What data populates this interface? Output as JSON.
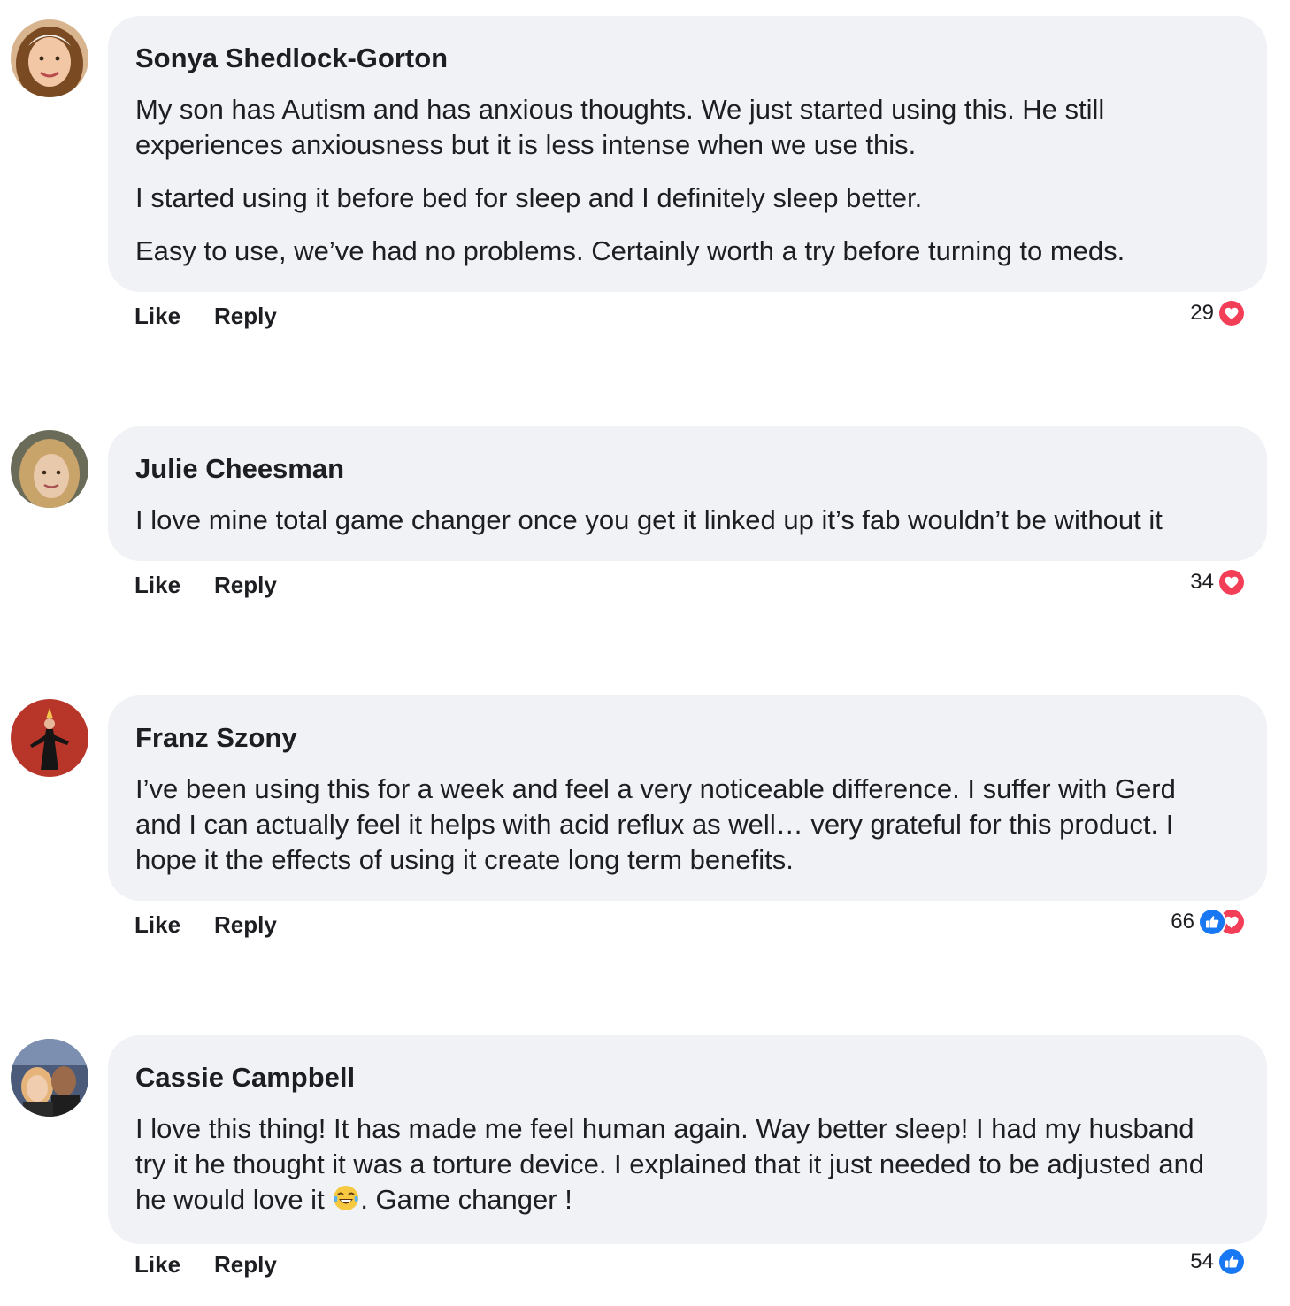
{
  "comments": [
    {
      "author": "Sonya Shedlock-Gorton",
      "paragraphs": [
        "My son has Autism and has anxious thoughts. We just started using this. He still",
        "experiences anxiousness but it is less intense when we use this.",
        "I started using it before bed for sleep and I definitely sleep better.",
        "Easy to use, we’ve had no problems. Certainly worth a try before turning to meds."
      ],
      "like_label": "Like",
      "reply_label": "Reply",
      "reaction_count": "29",
      "reaction_icons": [
        "love-icon"
      ]
    },
    {
      "author": "Julie Cheesman",
      "paragraphs": [
        "I love mine total game changer once you get it linked up it’s fab wouldn’t be without it"
      ],
      "like_label": "Like",
      "reply_label": "Reply",
      "reaction_count": "34",
      "reaction_icons": [
        "love-icon"
      ]
    },
    {
      "author": "Franz Szony",
      "paragraphs": [
        "I’ve been using this for a week and feel a very noticeable difference. I suffer with Gerd",
        "and I can actually feel it helps with acid reflux as well… very grateful for this product. I",
        "hope it the effects of using it create long term benefits."
      ],
      "like_label": "Like",
      "reply_label": "Reply",
      "reaction_count": "66",
      "reaction_icons": [
        "like-icon",
        "love-icon"
      ]
    },
    {
      "author": "Cassie Campbell",
      "paragraphs": [
        "I love this thing! It has made me feel human again. Way better sleep! I had my husband",
        "try it he thought it was a torture device. I explained that it just needed to be adjusted and",
        "he would love it",
        ". Game changer !"
      ],
      "like_label": "Like",
      "reply_label": "Reply",
      "reaction_count": "54",
      "reaction_icons": [
        "like-icon"
      ]
    }
  ],
  "colors": {
    "bubble_bg": "#f0f2f5",
    "text": "#1c1e21",
    "love": "#f33e58",
    "like": "#1877f2"
  }
}
